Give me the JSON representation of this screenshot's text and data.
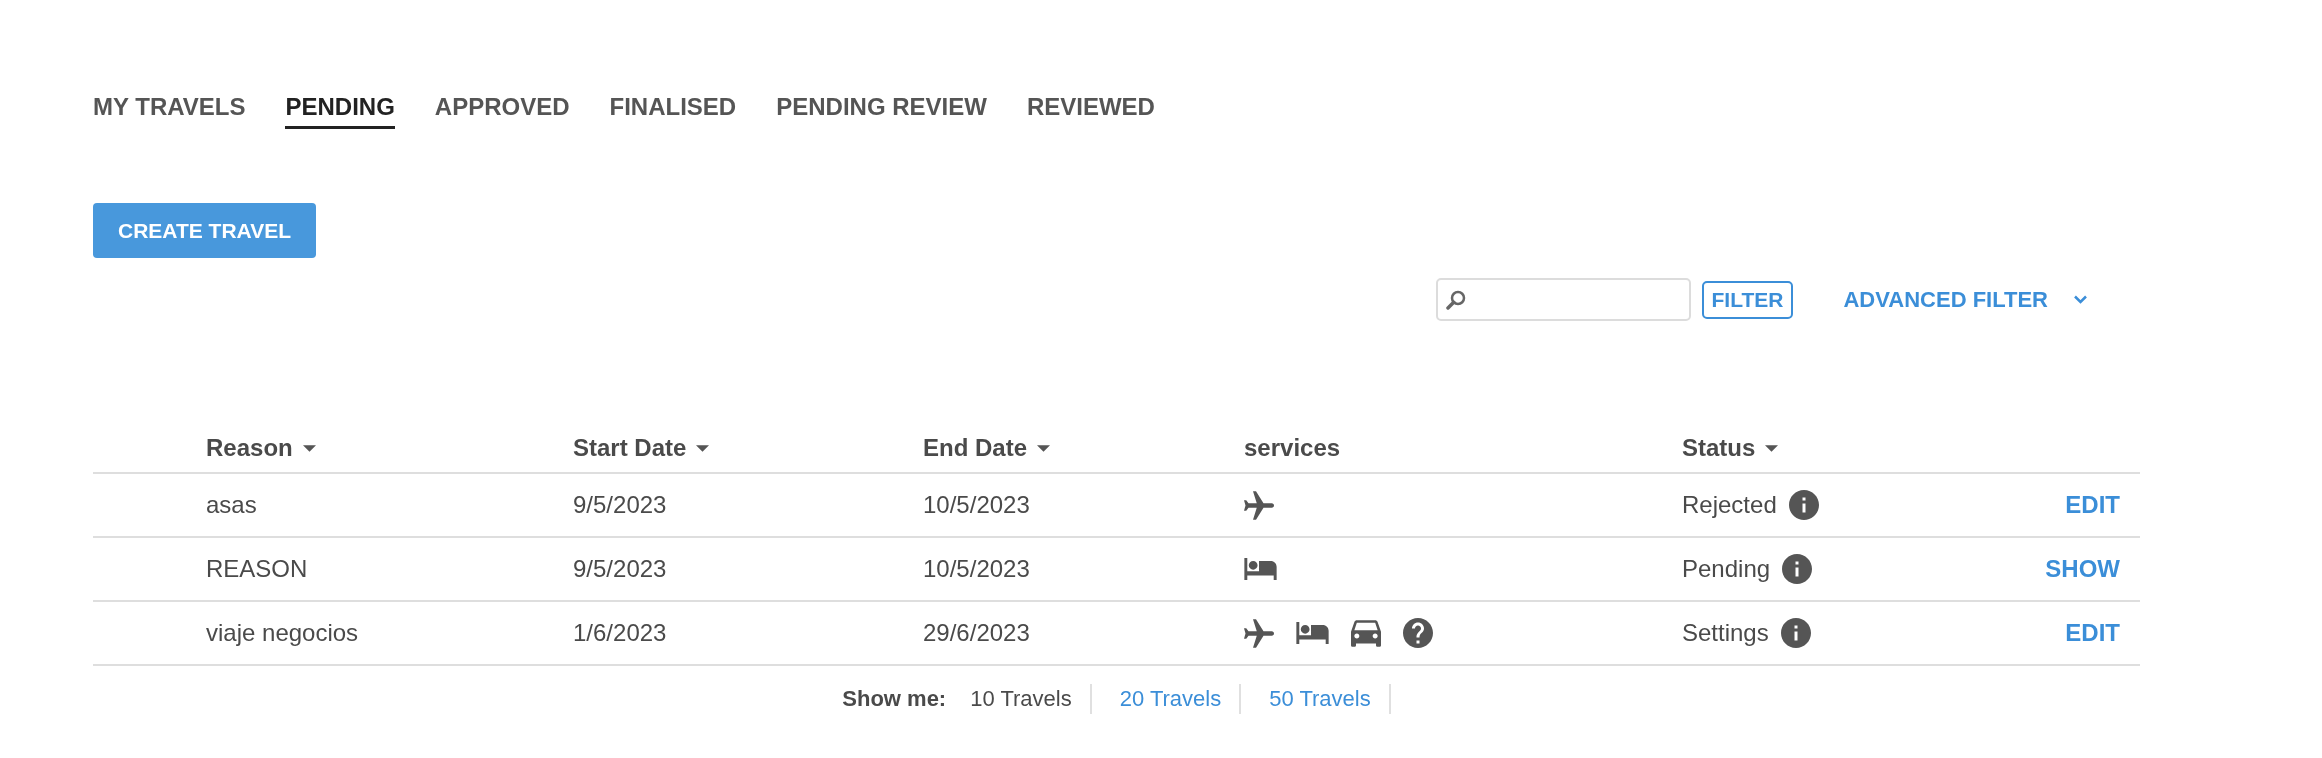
{
  "tabs": [
    {
      "label": "MY TRAVELS",
      "selected": false
    },
    {
      "label": "PENDING",
      "selected": true
    },
    {
      "label": "APPROVED",
      "selected": false
    },
    {
      "label": "FINALISED",
      "selected": false
    },
    {
      "label": "PENDING REVIEW",
      "selected": false
    },
    {
      "label": "REVIEWED",
      "selected": false
    }
  ],
  "create_button": {
    "label": "CREATE TRAVEL"
  },
  "filter_bar": {
    "filter_button": "FILTER",
    "advanced_filter": {
      "label": "ADVANCED FILTER",
      "expanded": false
    }
  },
  "table": {
    "columns": [
      {
        "label": "Reason",
        "sortable": true
      },
      {
        "label": "Start Date",
        "sortable": true
      },
      {
        "label": "End Date",
        "sortable": true
      },
      {
        "label": "services",
        "sortable": false
      },
      {
        "label": "Status",
        "sortable": true
      }
    ],
    "rows": [
      {
        "reason": "asas",
        "start_date": "9/5/2023",
        "end_date": "10/5/2023",
        "services": [
          {
            "kind": "flight"
          }
        ],
        "status": "Rejected",
        "action": "EDIT"
      },
      {
        "reason": "REASON",
        "start_date": "9/5/2023",
        "end_date": "10/5/2023",
        "services": [
          {
            "kind": "hotel"
          }
        ],
        "status": "Pending",
        "action": "SHOW"
      },
      {
        "reason": "viaje negocios",
        "start_date": "1/6/2023",
        "end_date": "29/6/2023",
        "services": [
          {
            "kind": "flight"
          },
          {
            "kind": "hotel"
          },
          {
            "kind": "car"
          },
          {
            "kind": "other"
          }
        ],
        "status": "Settings",
        "action": "EDIT"
      }
    ]
  },
  "page_size": {
    "label": "Show me:",
    "options": [
      {
        "label": "10 Travels",
        "selected": true
      },
      {
        "label": "20 Travels",
        "selected": false
      },
      {
        "label": "50 Travels",
        "selected": false
      }
    ]
  }
}
